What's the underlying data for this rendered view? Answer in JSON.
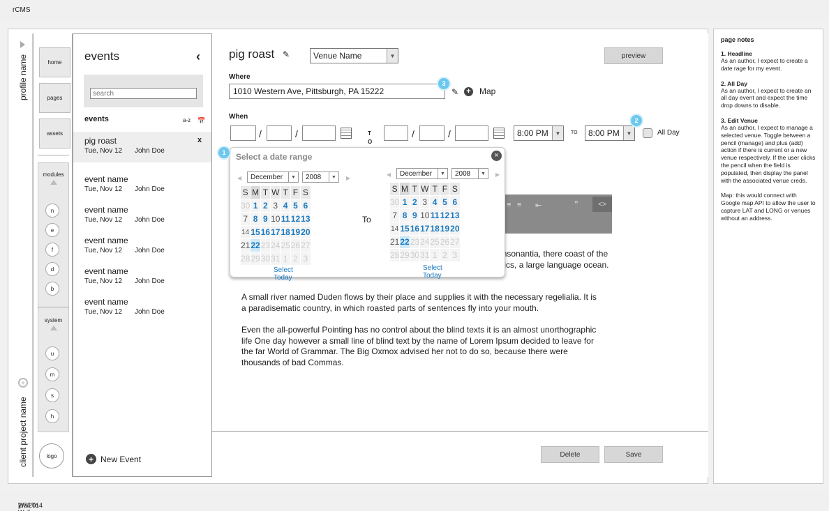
{
  "app": {
    "name": "rCMS"
  },
  "footer": {
    "date": "2/7/2014",
    "divider": "|",
    "company": "Wall To Wall Studios"
  },
  "vertical": {
    "profile": "profile name",
    "project": "client project name"
  },
  "nav": {
    "home": "home",
    "pages": "pages",
    "assets": "assets",
    "modules": "modules",
    "module_items": [
      "n",
      "e",
      "f",
      "d",
      "b"
    ],
    "system": "system",
    "system_items": [
      "u",
      "m",
      "s",
      "h"
    ],
    "logo": "logo"
  },
  "list": {
    "title": "events",
    "back_icon": "chevron-left-icon",
    "search_placeholder": "search",
    "header": "events",
    "sort": "a-z",
    "items": [
      {
        "name": "pig roast",
        "date": "Tue, Nov 12",
        "user": "John Doe",
        "remove": "x"
      },
      {
        "name": "event name",
        "date": "Tue, Nov 12",
        "user": "John Doe"
      },
      {
        "name": "event name",
        "date": "Tue, Nov 12",
        "user": "John Doe"
      },
      {
        "name": "event name",
        "date": "Tue, Nov 12",
        "user": "John Doe"
      },
      {
        "name": "event name",
        "date": "Tue, Nov 12",
        "user": "John Doe"
      },
      {
        "name": "event name",
        "date": "Tue, Nov 12",
        "user": "John Doe"
      }
    ],
    "new_event": "New Event"
  },
  "editor": {
    "title": "pig roast",
    "venue_select": "Venue Name",
    "preview": "preview",
    "where_label": "Where",
    "where_value": "1010 Western Ave, Pittsburgh, PA 15222",
    "map": "Map",
    "when_label": "When",
    "to_small": "T",
    "to_small2": "O",
    "slash": "/",
    "start_time": "8:00 PM",
    "to_label": "TO",
    "end_time": "8:00 PM",
    "all_day": "All Day",
    "paragraph1": "and Consonantia, there coast of the Semantics, a large language ocean.",
    "paragraph2": "A small river named Duden flows by their place and supplies it with the necessary regelialia. It is a paradisematic country, in which roasted parts of sentences fly into your mouth.",
    "paragraph3": "Even the all-powerful Pointing has no control about the blind texts it is an almost unorthographic life One day however a small line of blind text by the name of Lorem Ipsum decided to leave for the far World of Grammar. The Big Oxmox advised her not to do so, because there were thousands of bad Commas.",
    "delete": "Delete",
    "save": "Save",
    "bubbles": [
      "1",
      "2",
      "3"
    ]
  },
  "datepicker": {
    "title": "Select a date range",
    "to": "To",
    "month": "December",
    "year": "2008",
    "weekdays": [
      "S",
      "M",
      "T",
      "W",
      "T",
      "F",
      "S"
    ],
    "select_today": "Select Today",
    "rows": [
      [
        "30",
        "1",
        "2",
        "3",
        "4",
        "5",
        "6"
      ],
      [
        "7",
        "8",
        "9",
        "10",
        "11",
        "12",
        "13"
      ],
      [
        "14",
        "15",
        "16",
        "17",
        "18",
        "19",
        "20"
      ],
      [
        "21",
        "22",
        "23",
        "24",
        "25",
        "26",
        "27"
      ],
      [
        "28",
        "29",
        "30",
        "31",
        "1",
        "2",
        "3"
      ]
    ]
  },
  "notes": {
    "title": "page notes",
    "items": [
      {
        "title": "1. Headline",
        "body": "As an author, I expect to create a date rage for my event."
      },
      {
        "title": "2. All Day",
        "body": "As an author, I expect to create an all day event and expect the time drop downs to disable."
      },
      {
        "title": "3. Edit Venue",
        "body": "As an author, I expect to manage a selected venue.  Toggle between a pencil (manage) and plus (add) action if there is current or a new venue respectively. If the user clicks the pencil when the field is populated, then display the panel with the associated venue creds."
      },
      {
        "title": "",
        "body": "Map: this would connect with Google map API to allow the user to capture LAT and LONG or venues without an address."
      }
    ]
  }
}
